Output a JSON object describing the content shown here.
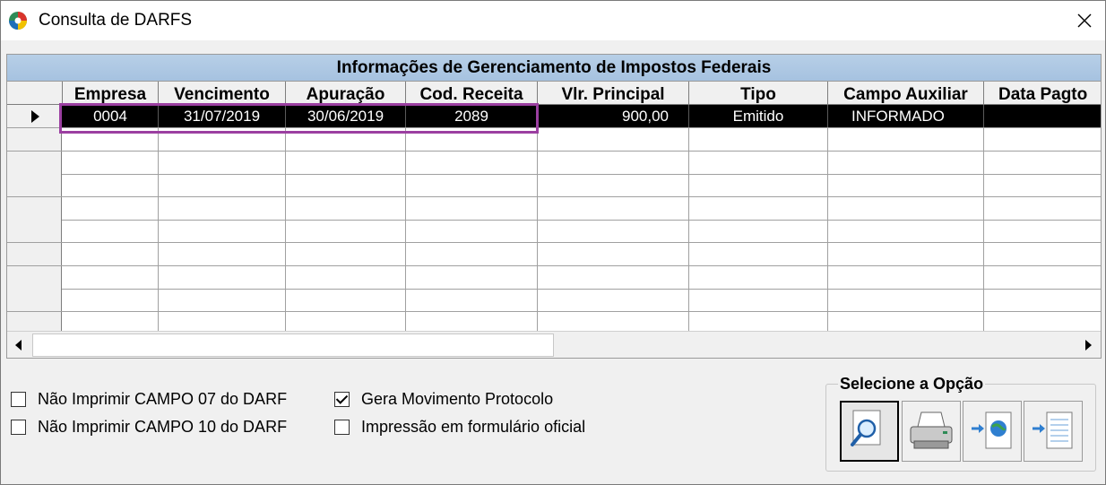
{
  "window": {
    "title": "Consulta de DARFS",
    "close_glyph": "✕"
  },
  "grid": {
    "title": "Informações de Gerenciamento de Impostos Federais",
    "columns": [
      "Empresa",
      "Vencimento",
      "Apuração",
      "Cod. Receita",
      "Vlr. Principal",
      "Tipo",
      "Campo Auxiliar",
      "Data Pagto"
    ],
    "rows": [
      [
        "0004",
        "31/07/2019",
        "30/06/2019",
        "2089",
        "900,00",
        "Emitido",
        "INFORMADO",
        ""
      ]
    ],
    "empty_rows": 9
  },
  "options": {
    "nao_imprimir_07": {
      "label": "Não Imprimir CAMPO 07 do DARF",
      "checked": false
    },
    "nao_imprimir_10": {
      "label": "Não Imprimir CAMPO 10 do DARF",
      "checked": false
    },
    "gera_movimento": {
      "label": "Gera Movimento Protocolo",
      "checked": true
    },
    "formulario_oficial": {
      "label": "Impressão em formulário oficial",
      "checked": false
    }
  },
  "select_group": {
    "legend": "Selecione a Opção",
    "buttons": [
      "magnifier-icon",
      "printer-icon",
      "web-export-icon",
      "document-export-icon"
    ]
  },
  "colors": {
    "highlight": "#9b3fa1",
    "grid_title_bg": "#a6c2e0",
    "selected_row": "#000000"
  }
}
